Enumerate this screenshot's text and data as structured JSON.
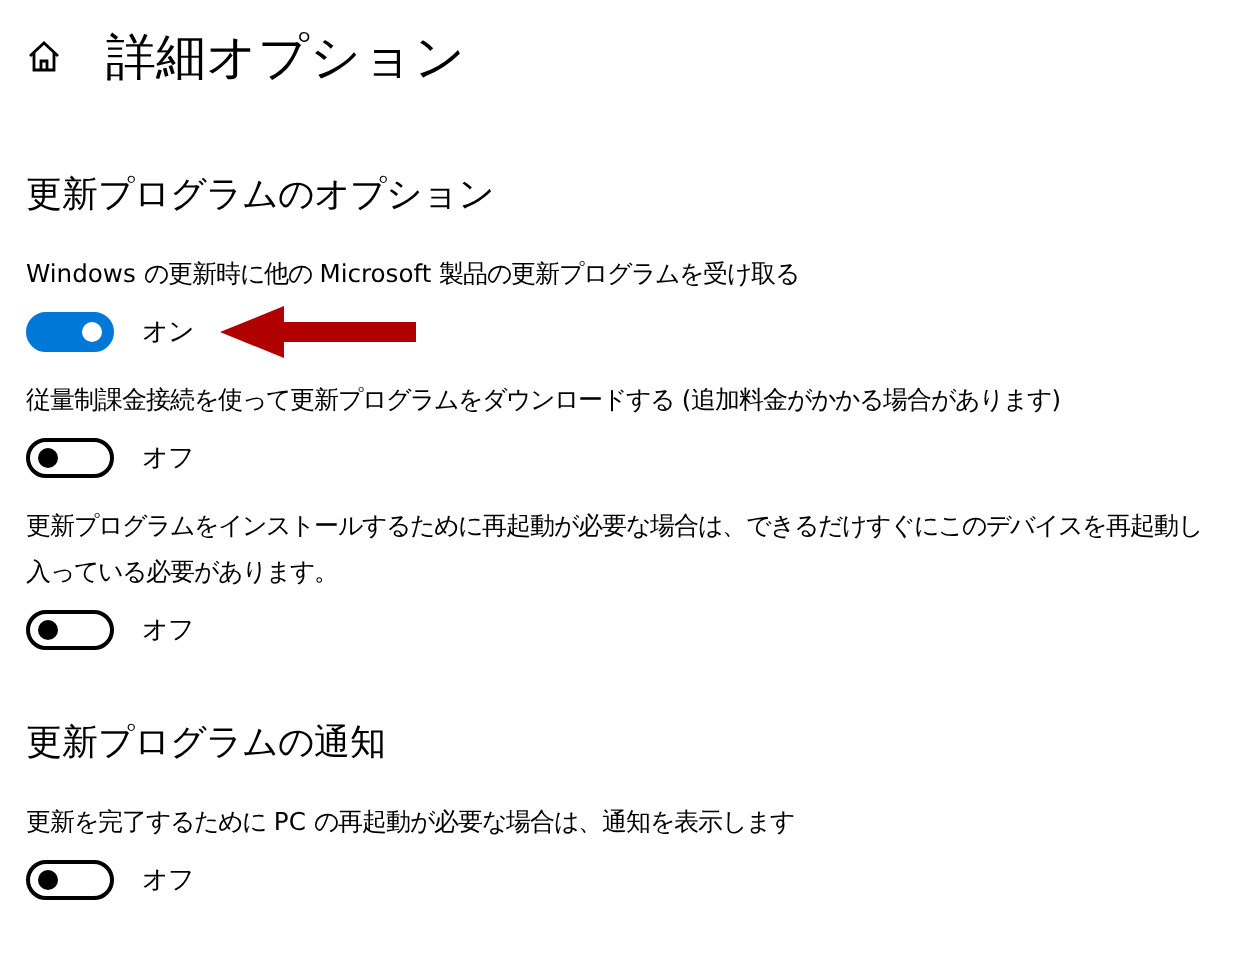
{
  "page": {
    "title": "詳細オプション"
  },
  "sections": [
    {
      "heading": "更新プログラムのオプション",
      "settings": [
        {
          "description_lines": [
            "Windows の更新時に他の Microsoft 製品の更新プログラムを受け取る"
          ],
          "on": true,
          "state_label": "オン"
        },
        {
          "description_lines": [
            "従量制課金接続を使って更新プログラムをダウンロードする (追加料金がかかる場合があります)"
          ],
          "on": false,
          "state_label": "オフ"
        },
        {
          "description_lines": [
            "更新プログラムをインストールするために再起動が必要な場合は、できるだけすぐにこのデバイスを再起動し",
            "入っている必要があります。"
          ],
          "on": false,
          "state_label": "オフ"
        }
      ]
    },
    {
      "heading": "更新プログラムの通知",
      "settings": [
        {
          "description_lines": [
            "更新を完了するために PC の再起動が必要な場合は、通知を表示します"
          ],
          "on": false,
          "state_label": "オフ"
        }
      ]
    }
  ]
}
